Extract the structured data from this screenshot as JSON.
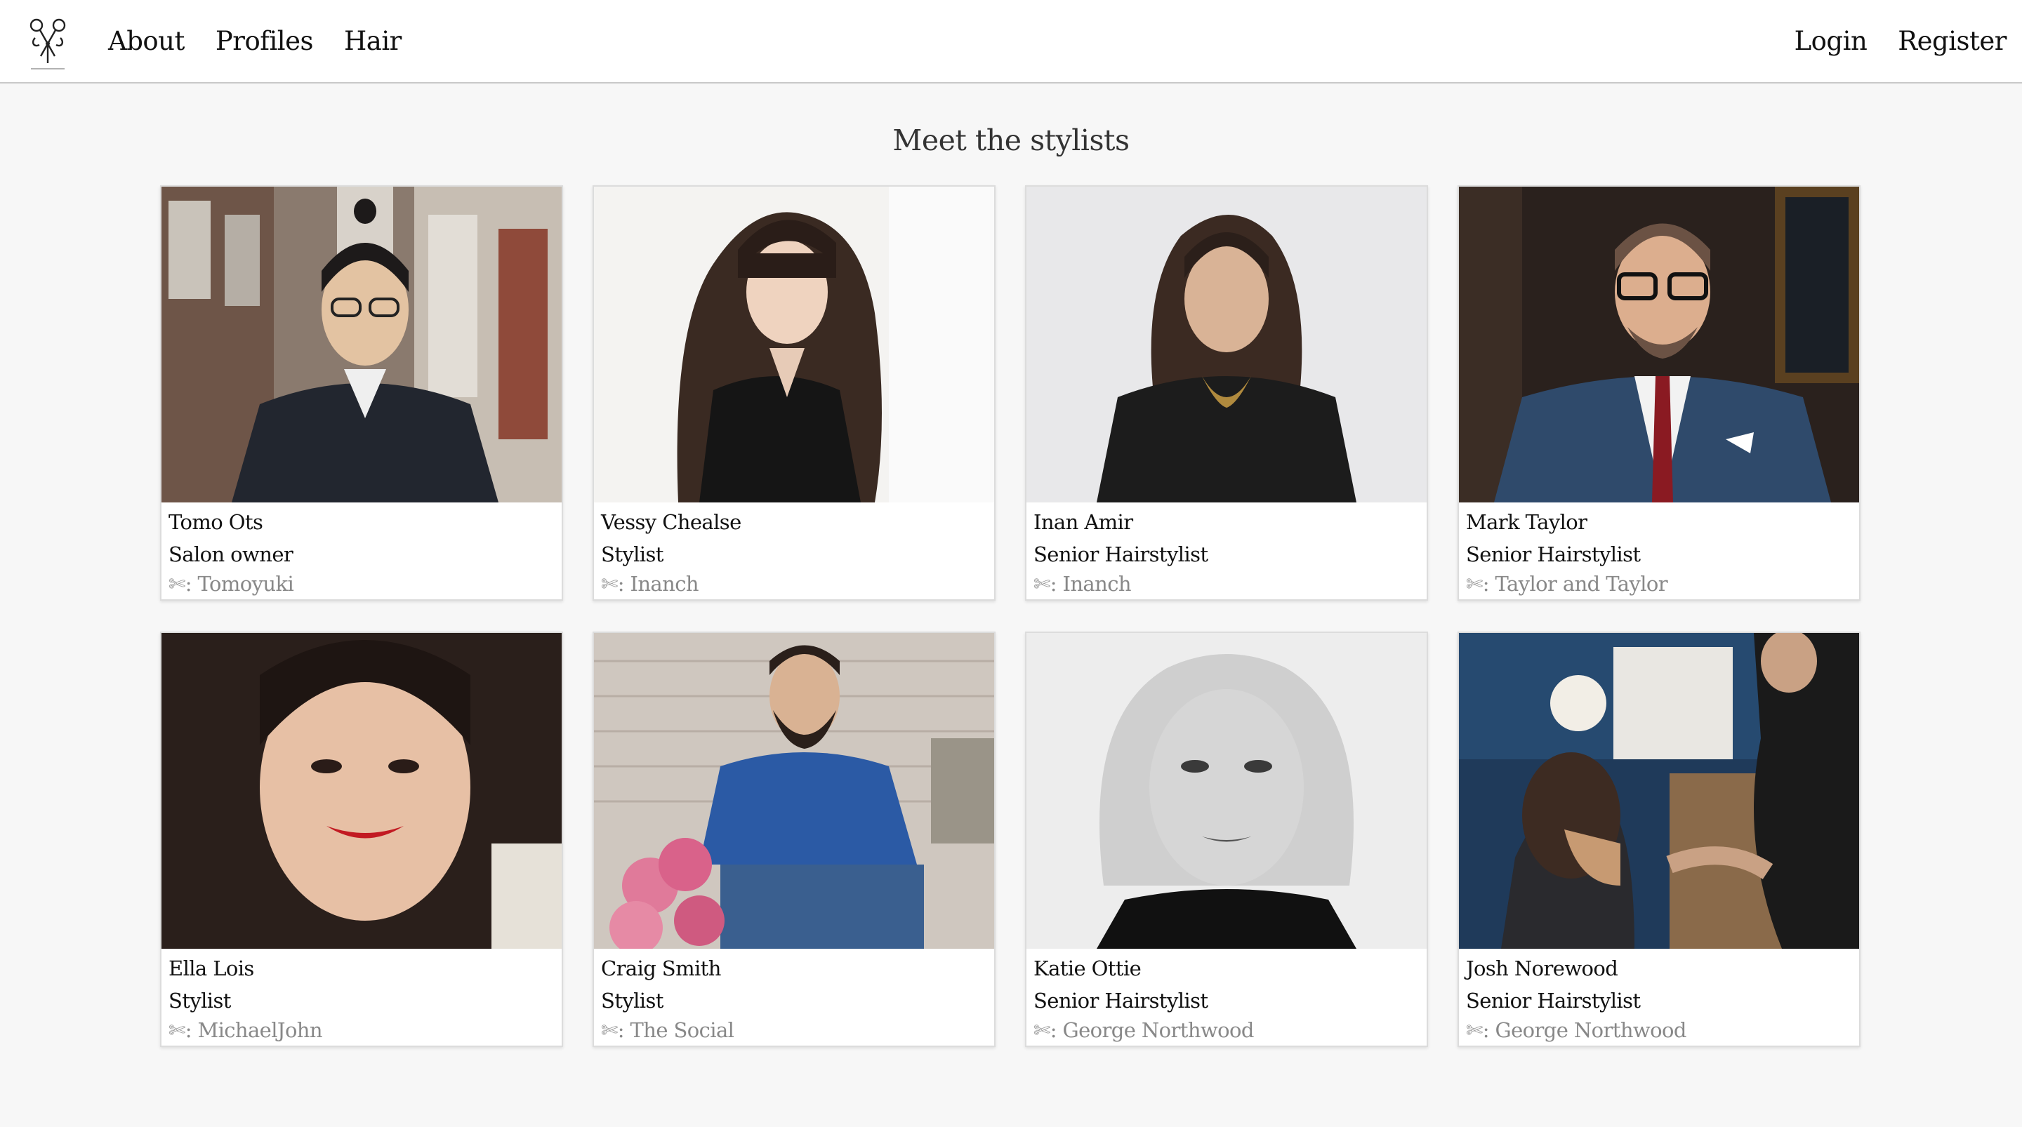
{
  "nav": {
    "links": [
      "About",
      "Profiles",
      "Hair"
    ],
    "right": [
      "Login",
      "Register"
    ],
    "logo_icon": "scissors-logo-icon"
  },
  "page": {
    "title": "Meet the stylists"
  },
  "salon_prefix": ": ",
  "stylists": [
    {
      "name": "Tomo Ots",
      "role": "Salon owner",
      "salon": "Tomoyuki"
    },
    {
      "name": "Vessy Chealse",
      "role": "Stylist",
      "salon": "Inanch"
    },
    {
      "name": "Inan Amir",
      "role": "Senior Hairstylist",
      "salon": "Inanch"
    },
    {
      "name": "Mark Taylor",
      "role": "Senior Hairstylist",
      "salon": "Taylor and Taylor"
    },
    {
      "name": "Ella Lois",
      "role": "Stylist",
      "salon": "MichaelJohn"
    },
    {
      "name": "Craig Smith",
      "role": "Stylist",
      "salon": "The Social"
    },
    {
      "name": "Katie Ottie",
      "role": "Senior Hairstylist",
      "salon": "George Northwood"
    },
    {
      "name": "Josh Norewood",
      "role": "Senior Hairstylist",
      "salon": "George Northwood"
    }
  ],
  "colors": {
    "background": "#f7f7f7",
    "navbar": "#ffffff",
    "card_border": "#dcdcdc",
    "salon_text": "#888888"
  }
}
